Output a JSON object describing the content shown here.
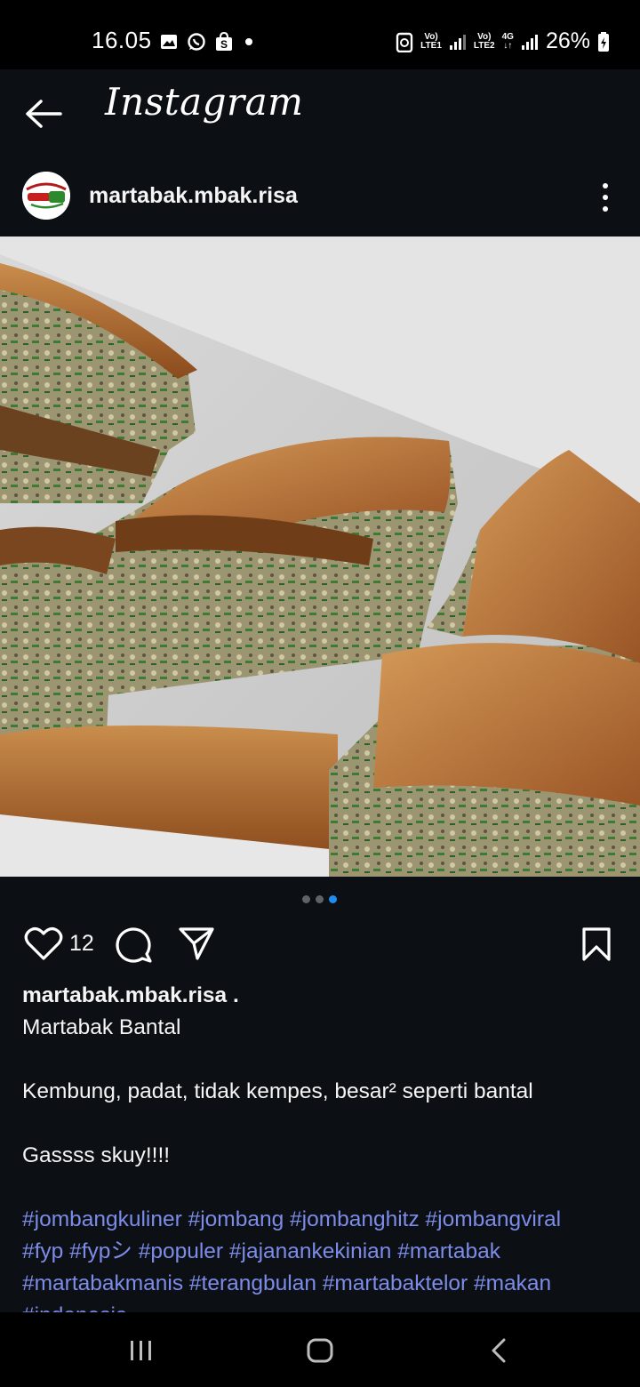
{
  "status_bar": {
    "time": "16.05",
    "left_icons": [
      "gallery-icon",
      "whatsapp-icon",
      "shopee-icon",
      "dot-icon"
    ],
    "sim1_top": "Vo)",
    "sim1_bottom": "LTE1",
    "sim2_top": "Vo)",
    "sim2_bottom": "LTE2",
    "network_type": "4G",
    "battery": "26%"
  },
  "header": {
    "app_title": "Instagram",
    "back_icon": "arrow-left-icon"
  },
  "post": {
    "username": "martabak.mbak.risa",
    "more_icon": "more-vertical-icon",
    "carousel": {
      "count": 3,
      "active": 3
    },
    "likes": "12",
    "caption": {
      "username": "martabak.mbak.risa .",
      "lines": [
        "Martabak Bantal",
        "",
        "Kembung, padat, tidak kempes, besar² seperti bantal",
        "",
        "Gassss skuy!!!!",
        ""
      ],
      "hashtag_lines": [
        "#jombangkuliner #jombang #jombanghitz #jombangviral",
        "#fyp #fypシ #populer #jajanankekinian #martabak",
        "#martabakmanis #terangbulan #martabaktelor #makan",
        "#indonesia"
      ]
    }
  },
  "colors": {
    "background": "#0c1014",
    "text": "#f5f5f5",
    "hashtag": "#7c8ce8",
    "active_dot": "#1f8cf0"
  },
  "nav_bar": {
    "icons": [
      "recent-apps-icon",
      "home-icon",
      "back-icon"
    ]
  }
}
